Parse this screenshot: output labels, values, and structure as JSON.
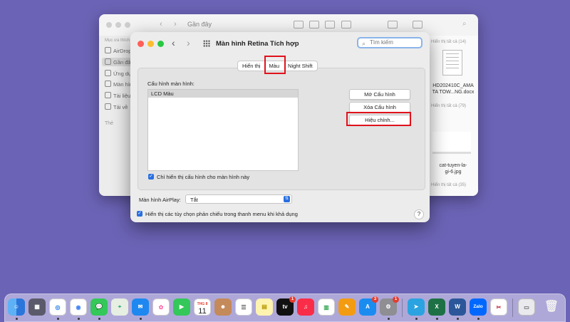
{
  "finder": {
    "title": "Gần đây",
    "sidebar_header": "Mục ưa thích",
    "sidebar_items": [
      "AirDrop",
      "Gần đây",
      "Ứng dụng",
      "Màn hình",
      "Tài liệu",
      "Tải về"
    ],
    "tags_header": "Thẻ",
    "show_all_labels": [
      "Hiển thị tất cả (14)",
      "Hiển thị tất cả (79)",
      "Hiển thị tất cả (35)"
    ],
    "files": [
      {
        "name_line1": "HD202410C_AMA",
        "name_line2": "TA TOW...NG.docx"
      },
      {
        "name_line1": "cat-tuyen-la-",
        "name_line2": "gi-6.jpg"
      }
    ]
  },
  "prefs": {
    "title": "Màn hình Retina Tích hợp",
    "search_placeholder": "Tìm kiếm",
    "tabs": [
      "Hiển thị",
      "Màu",
      "Night Shift"
    ],
    "selected_tab": "Màu",
    "profile_label": "Cấu hình màn hình:",
    "profiles": [
      "LCD Màu"
    ],
    "open_profile_button": "Mở Cấu hình",
    "delete_profile_button": "Xóa Cấu hình",
    "calibrate_button": "Hiệu chỉnh...",
    "show_only_checkbox": "Chỉ hiển thị cấu hình cho màn hình này",
    "airplay_label": "Màn hình AirPlay:",
    "airplay_value": "Tắt",
    "mirroring_checkbox": "Hiển thị các tùy chọn phản chiếu trong thanh menu khi khả dụng",
    "help": "?"
  },
  "dock": {
    "calendar_month": "THG 8",
    "calendar_day": "11",
    "tv_label": "tv",
    "zalo_label": "Zalo",
    "badges": {
      "tv": "1",
      "appstore": "3",
      "settings": "1"
    }
  },
  "colors": {
    "desktop": "#6b63b5",
    "highlight_red": "#e0121c",
    "accent_blue": "#2a6fe0"
  }
}
